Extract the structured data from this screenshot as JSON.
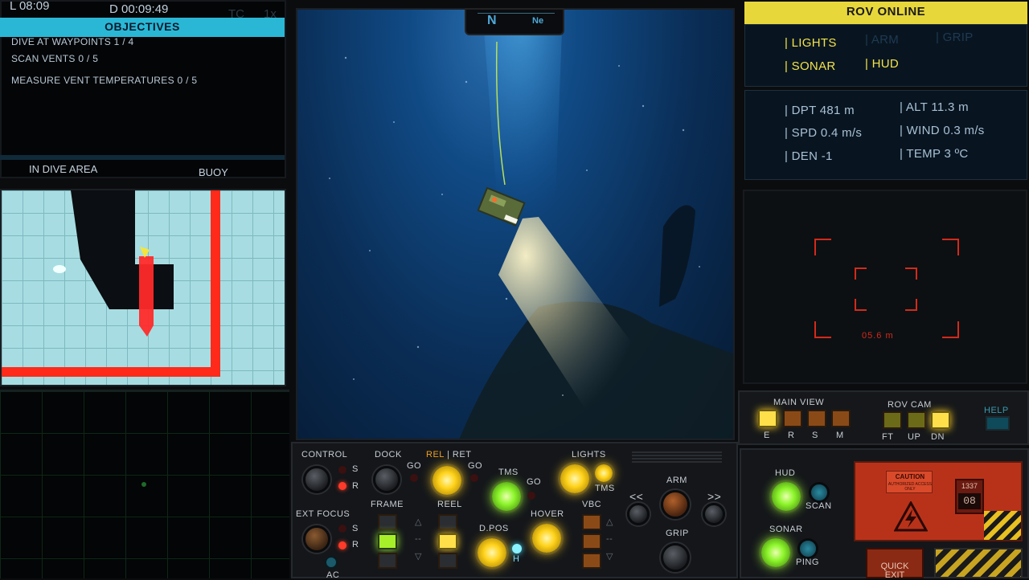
{
  "hud": {
    "clock_left": "L 08:09",
    "clock_dive": "D 00:09:49",
    "tc": "TC",
    "speed_mult": "1x"
  },
  "objectives": {
    "header": "OBJECTIVES",
    "items": [
      "DIVE AT WAYPOINTS 1 / 4",
      "SCAN VENTS 0 / 5",
      "MEASURE VENT TEMPERATURES 0 / 5"
    ],
    "status_left": "IN DIVE AREA",
    "status_right": "BUOY"
  },
  "compass": {
    "primary": "N",
    "secondary": "Ne"
  },
  "rov": {
    "status": "ROV ONLINE",
    "toggles": [
      {
        "label": "| LIGHTS",
        "active": true
      },
      {
        "label": "| ARM",
        "active": false
      },
      {
        "label": "| GRIP",
        "active": false
      },
      {
        "label": "| SONAR",
        "active": true
      },
      {
        "label": "| HUD",
        "active": true
      }
    ],
    "telemetry": [
      "| DPT 481 m",
      "| ALT 11.3 m",
      "| SPD 0.4 m/s",
      "| WIND 0.3 m/s",
      "| DEN -1",
      "| TEMP 3 ºC"
    ],
    "cam_range": "05.6 m"
  },
  "view_controls": {
    "main_view_label": "MAIN VIEW",
    "main_view_buttons": [
      "E",
      "R",
      "S",
      "M"
    ],
    "main_view_active": 0,
    "rov_cam_label": "ROV CAM",
    "rov_cam_buttons": [
      "FT",
      "UP",
      "DN"
    ],
    "rov_cam_active": 2,
    "help": "HELP"
  },
  "controls": {
    "control": "CONTROL",
    "ext_focus": "EXT FOCUS",
    "s": "S",
    "r": "R",
    "ac": "AC",
    "dock": "DOCK",
    "go": "GO",
    "rel": "REL",
    "ret": "| RET",
    "frame": "FRAME",
    "reel": "REEL",
    "tms": "TMS",
    "dpos": "D.POS",
    "h": "H",
    "hover": "HOVER",
    "lights": "LIGHTS",
    "vbc": "VBC",
    "arm": "ARM",
    "grip": "GRIP",
    "prev": "<<",
    "next": ">>",
    "hud": "HUD",
    "scan": "SCAN",
    "sonar": "SONAR",
    "ping": "PING",
    "caution": "CAUTION",
    "caution_sub": "AUTHORIZED ACCESS ONLY",
    "counter_label": "1337",
    "counter_value": "08",
    "quick_exit": "QUICK EXIT",
    "arrow_up": "△",
    "arrow_down": "▽",
    "dash": "--"
  }
}
